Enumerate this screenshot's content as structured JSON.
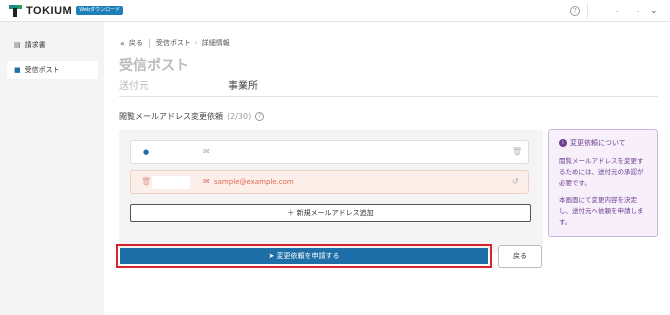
{
  "header": {
    "brand": "TOKIUM",
    "badge": "Webダウンロード",
    "help_icon": "question-circle-icon",
    "user_name": ".",
    "user_name2": "."
  },
  "sidebar": {
    "items": [
      {
        "label": "請求書",
        "icon": "document-icon"
      },
      {
        "label": "受信ポスト",
        "icon": "folder-icon"
      }
    ]
  },
  "breadcrumb": {
    "back": "戻る",
    "items": [
      "受信ポスト",
      "詳細情報"
    ]
  },
  "page": {
    "title": "受信ポスト",
    "sender_label": "送付元",
    "sender_value": "事業所"
  },
  "section": {
    "title": "閲覧メールアドレス変更依頼",
    "count": "(2/30)"
  },
  "rows": [
    {
      "name": "",
      "email": ""
    },
    {
      "name": "",
      "email": "sample@example.com"
    }
  ],
  "add_button": "＋ 新規メールアドレス追加",
  "info": {
    "title": "変更依頼について",
    "p1": "閲覧メールアドレスを変更するためには、送付元の承認が必要です。",
    "p2": "本画面にて変更内容を決定し、送付元へ依頼を申請します。"
  },
  "submit_button": "変更依頼を申請する",
  "back_button": "戻る",
  "colors": {
    "primary": "#1e6fa8",
    "highlight": "#d9232d",
    "info": "#6d3f91"
  }
}
